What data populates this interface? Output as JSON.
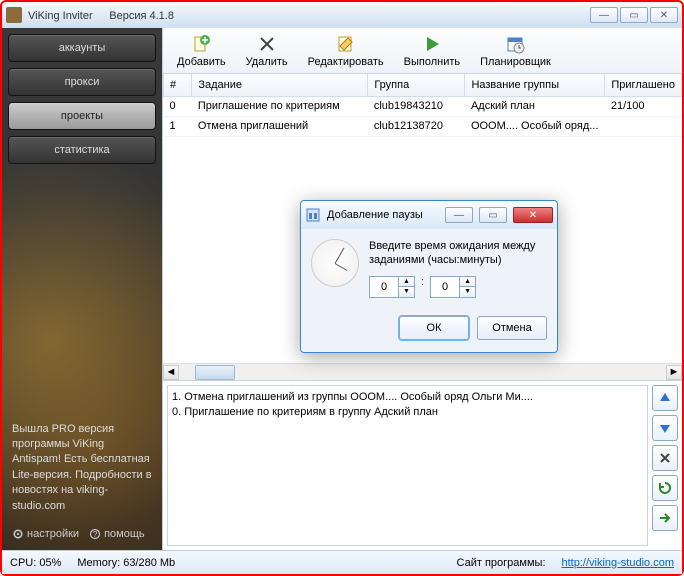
{
  "titlebar": {
    "app": "ViKing Inviter",
    "version": "Версия 4.1.8"
  },
  "sidebar": {
    "nav": [
      "аккаунты",
      "прокси",
      "проекты",
      "статистика"
    ],
    "active_index": 2,
    "promo": "Вышла PRO версия программы ViKing Antispam! Есть бесплатная Lite-версия. Подробности в новостях на viking-studio.com",
    "settings": "настройки",
    "help": "помощь"
  },
  "toolbar": {
    "add": "Добавить",
    "delete": "Удалить",
    "edit": "Редактировать",
    "run": "Выполнить",
    "scheduler": "Планировщик"
  },
  "table": {
    "headers": [
      "#",
      "Задание",
      "Группа",
      "Название группы",
      "Приглашено"
    ],
    "rows": [
      {
        "idx": "0",
        "task": "Приглашение по критериям",
        "group": "club19843210",
        "gname": "Адский план",
        "invited": "21/100"
      },
      {
        "idx": "1",
        "task": "Отмена приглашений",
        "group": "club12138720",
        "gname": "ОООМ.... Особый оряд...",
        "invited": ""
      }
    ]
  },
  "log": {
    "lines": [
      "1. Отмена приглашений из группы  ОООМ.... Особый оряд Ольги Ми....",
      "0. Приглашение по критериям в группу  Адский план"
    ]
  },
  "status": {
    "cpu": "CPU: 05%",
    "mem": "Memory: 63/280 Mb",
    "site_label": "Сайт программы:",
    "site_url": "http://viking-studio.com"
  },
  "modal": {
    "title": "Добавление паузы",
    "text": "Введите время ожидания между заданиями (часы:минуты)",
    "hours": "0",
    "minutes": "0",
    "ok": "ОК",
    "cancel": "Отмена"
  }
}
